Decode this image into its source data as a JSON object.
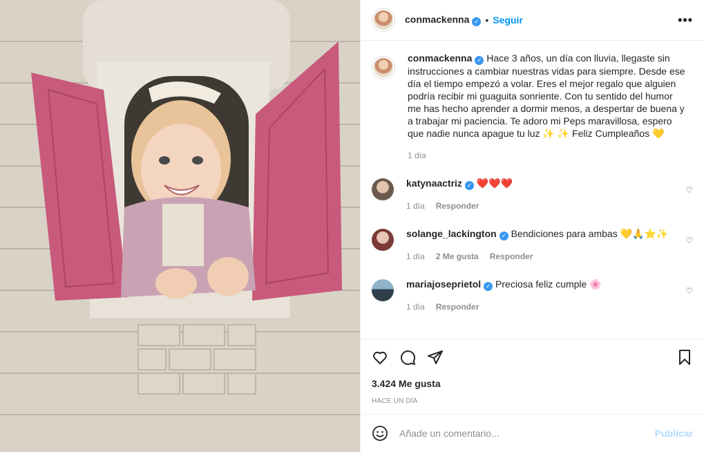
{
  "post": {
    "username": "conmackenna",
    "follow_label": "Seguir",
    "dot": "•",
    "more_label": "•••"
  },
  "caption": {
    "username": "conmackenna",
    "text": "Hace 3 años, un día con lluvia, llegaste sin instrucciones a cambiar nuestras vidas para siempre. Desde ese día el tiempo empezó a volar. Eres el mejor regalo que alguien podría recibir mi guaguita sonriente. Con tu sentido del humor me has hecho aprender a dormir menos, a despertar de buena y a trabajar mi paciencia. Te adoro mi Peps maravillosa, espero que nadie nunca apague tu luz ✨ ✨ Feliz Cumpleaños 💛",
    "time": "1 día"
  },
  "comments": [
    {
      "username": "katynaactriz",
      "text": "❤️❤️❤️",
      "time": "1 día",
      "likes": "",
      "reply": "Responder",
      "avatar_color": "#6b5a4e"
    },
    {
      "username": "solange_lackington",
      "text": "Bendiciones para ambas 💛🙏⭐✨",
      "time": "1 día",
      "likes": "2 Me gusta",
      "reply": "Responder",
      "avatar_color": "#7a3b38"
    },
    {
      "username": "mariajoseprietol",
      "text": "Preciosa feliz cumple 🌸",
      "time": "1 día",
      "likes": "",
      "reply": "Responder",
      "avatar_color": "#2f3f4a"
    }
  ],
  "stats": {
    "likes": "3.424 Me gusta",
    "posted": "HACE UN DÍA"
  },
  "composer": {
    "placeholder": "Añade un comentario...",
    "publish_label": "Publicar"
  },
  "icons": {
    "like": "heart-icon",
    "comment": "comment-icon",
    "share": "paper-plane-icon",
    "save": "bookmark-icon",
    "emoji": "smiley-icon",
    "verified": "verified-badge-icon"
  },
  "colors": {
    "accent": "#0095f6",
    "verified": "#3897f0",
    "muted": "#8e8e8e",
    "publish_disabled": "#b3dbff",
    "shutter": "#c85a7c"
  }
}
